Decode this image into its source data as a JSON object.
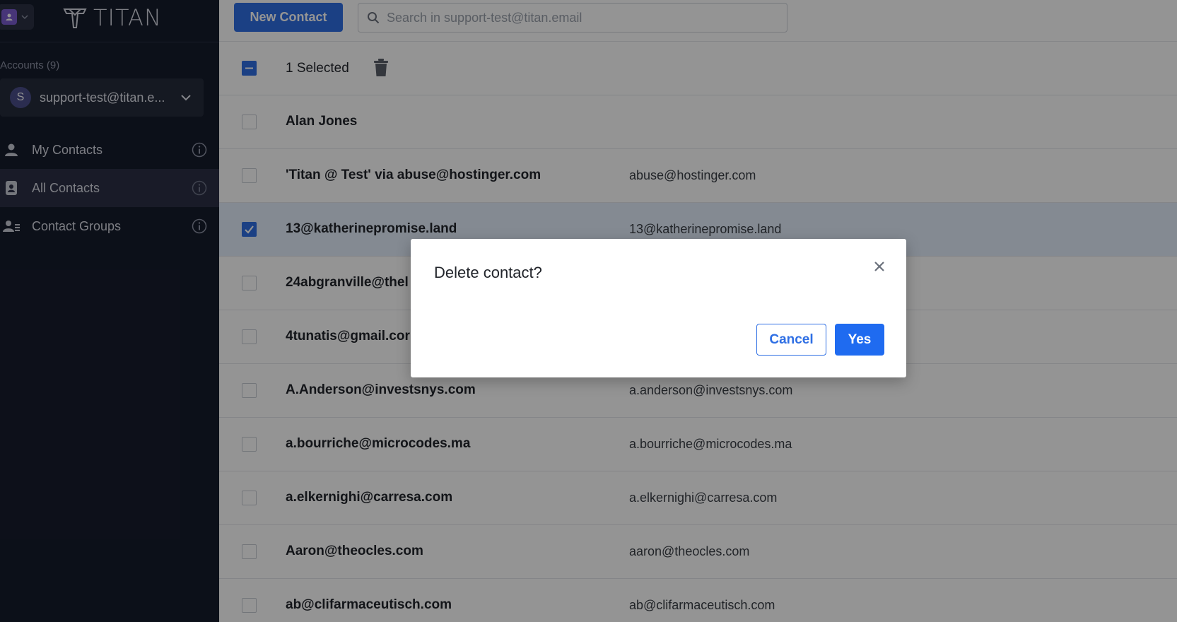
{
  "app": {
    "logo_text": "TITAN"
  },
  "sidebar": {
    "accounts_label": "Accounts (9)",
    "account": {
      "avatar_letter": "S",
      "email": "support-test@titan.e..."
    },
    "items": [
      {
        "label": "My Contacts",
        "icon": "person-icon",
        "active": false
      },
      {
        "label": "All Contacts",
        "icon": "contact-book-icon",
        "active": true
      },
      {
        "label": "Contact Groups",
        "icon": "group-icon",
        "active": false
      }
    ]
  },
  "toolbar": {
    "new_contact_label": "New Contact",
    "search_placeholder": "Search in support-test@titan.email"
  },
  "selection": {
    "label": "1 Selected"
  },
  "contacts": [
    {
      "name": "Alan Jones",
      "email": "",
      "checked": false
    },
    {
      "name": "'Titan @ Test' via abuse@hostinger.com",
      "email": "abuse@hostinger.com",
      "checked": false
    },
    {
      "name": "13@katherinepromise.land",
      "email": "13@katherinepromise.land",
      "checked": true
    },
    {
      "name": "24abgranville@thel",
      "email": "",
      "checked": false
    },
    {
      "name": "4tunatis@gmail.cor",
      "email": "",
      "checked": false
    },
    {
      "name": "A.Anderson@investsnys.com",
      "email": "a.anderson@investsnys.com",
      "checked": false
    },
    {
      "name": "a.bourriche@microcodes.ma",
      "email": "a.bourriche@microcodes.ma",
      "checked": false
    },
    {
      "name": "a.elkernighi@carresa.com",
      "email": "a.elkernighi@carresa.com",
      "checked": false
    },
    {
      "name": "Aaron@theocles.com",
      "email": "aaron@theocles.com",
      "checked": false
    },
    {
      "name": "ab@clifarmaceutisch.com",
      "email": "ab@clifarmaceutisch.com",
      "checked": false
    }
  ],
  "dialog": {
    "title": "Delete contact?",
    "cancel_label": "Cancel",
    "yes_label": "Yes"
  },
  "colors": {
    "accent": "#2f6fe4",
    "sidebar_bg": "#161c2c"
  }
}
